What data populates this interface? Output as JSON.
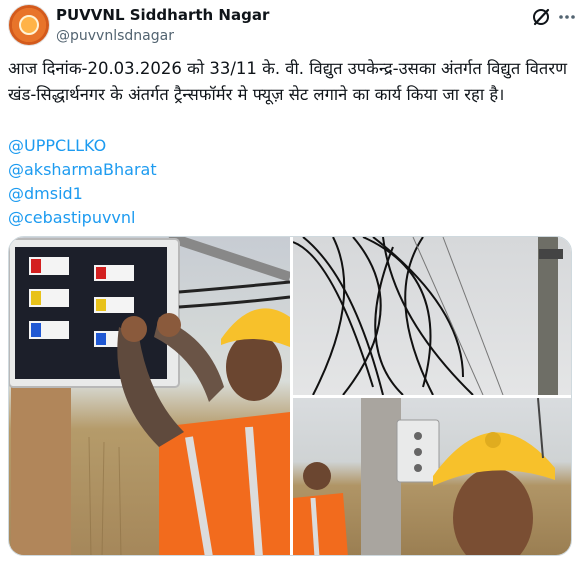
{
  "account": {
    "name": "PUVVNL Siddharth Nagar",
    "handle": "@puvvnlsdnagar",
    "avatar": "puvvnl-logo"
  },
  "actions": {
    "grok_icon": "grok-icon",
    "more_icon": "more-icon"
  },
  "post": {
    "text": "आज दिनांक-20.03.2026 को 33/11 के. वी. विद्युत उपकेन्द्र-उसका अंतर्गत विद्युत वितरण खंड-सिद्धार्थनगर के अंतर्गत ट्रैन्सफॉर्मर मे फ्यूज़ सेट लगाने का कार्य किया जा रहा है।",
    "mentions": [
      "@UPPCLLKO",
      "@aksharmaBharat",
      "@dmsid1",
      "@cebastipuvvnl"
    ]
  },
  "media": {
    "photos": [
      "fuse-box-worker-photo",
      "overhead-wires-photo",
      "pole-workers-photo"
    ]
  },
  "colors": {
    "link": "#1d9bf0",
    "secondary": "#536471",
    "vest": "#f26b1d",
    "helmet": "#f7c12b"
  }
}
